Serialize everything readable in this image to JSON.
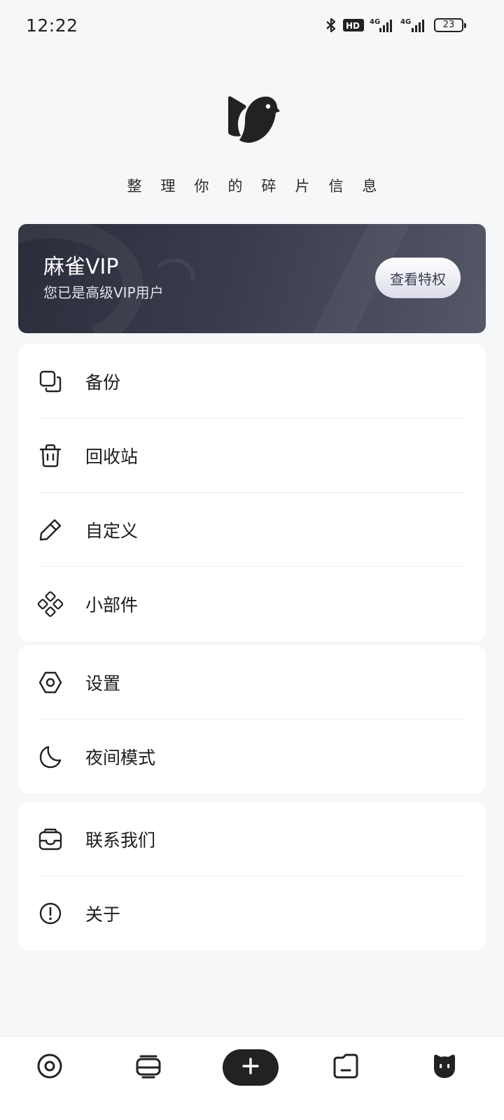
{
  "status_bar": {
    "time": "12:22",
    "battery": "23",
    "icons": [
      "bluetooth-icon",
      "hd-icon",
      "signal-4g-icon",
      "signal-4g-icon",
      "battery-icon"
    ]
  },
  "header": {
    "logo": "bird-logo-icon",
    "tagline": "整理你的碎片信息"
  },
  "vip": {
    "title": "麻雀VIP",
    "subtitle": "您已是高级VIP用户",
    "button": "查看特权"
  },
  "menu_groups": [
    {
      "items": [
        {
          "label": "备份",
          "icon": "backup-icon"
        },
        {
          "label": "回收站",
          "icon": "trash-icon"
        },
        {
          "label": "自定义",
          "icon": "pencil-icon"
        },
        {
          "label": "小部件",
          "icon": "widgets-icon"
        }
      ]
    },
    {
      "items": [
        {
          "label": "设置",
          "icon": "settings-icon"
        },
        {
          "label": "夜间模式",
          "icon": "moon-icon"
        }
      ]
    },
    {
      "items": [
        {
          "label": "联系我们",
          "icon": "inbox-icon"
        },
        {
          "label": "关于",
          "icon": "info-icon"
        }
      ]
    }
  ],
  "bottom_nav": [
    "target-icon",
    "cards-icon",
    "add-icon",
    "folder-icon",
    "profile-icon"
  ],
  "colors": {
    "background": "#f5f7f9",
    "vip_card_dark": "#2b2d3b",
    "vip_card_light": "#555868",
    "add_button": "#222222"
  }
}
